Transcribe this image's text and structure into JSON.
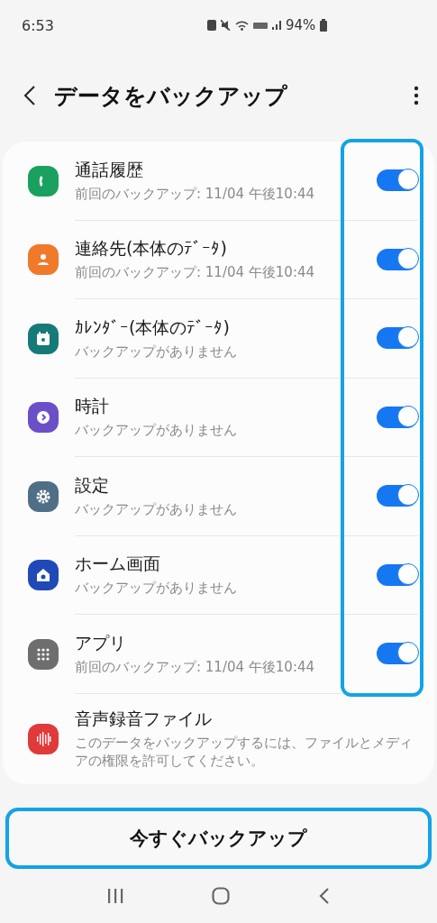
{
  "status_bar": {
    "time": "6:53",
    "battery": "94%"
  },
  "header": {
    "title": "データをバックアップ"
  },
  "items": [
    {
      "kind": "toggle",
      "color": "#1aa160",
      "title": "通話履歴",
      "subtitle": "前回のバックアップ: 11/04 午後10:44",
      "on": true
    },
    {
      "kind": "toggle",
      "color": "#f07a2a",
      "title": "連絡先(本体のﾃﾞｰﾀ)",
      "subtitle": "前回のバックアップ: 11/04 午後10:44",
      "on": true
    },
    {
      "kind": "toggle",
      "color": "#167a78",
      "title": "ｶﾚﾝﾀﾞｰ(本体のﾃﾞｰﾀ)",
      "subtitle": "バックアップがありません",
      "on": true
    },
    {
      "kind": "toggle",
      "color": "#6a4fc8",
      "title": "時計",
      "subtitle": "バックアップがありません",
      "on": true
    },
    {
      "kind": "toggle",
      "color": "#4f6f86",
      "title": "設定",
      "subtitle": "バックアップがありません",
      "on": true
    },
    {
      "kind": "toggle",
      "color": "#2049b8",
      "title": "ホーム画面",
      "subtitle": "バックアップがありません",
      "on": true
    },
    {
      "kind": "toggle",
      "color": "#6e6e6e",
      "title": "アプリ",
      "subtitle": "前回のバックアップ: 11/04 午後10:44",
      "on": true
    },
    {
      "kind": "info",
      "color": "#e03a3a",
      "title": "音声録音ファイル",
      "subtitle": "このデータをバックアップするには、ファイルとメディアの権限を許可してください。"
    }
  ],
  "backup_button": {
    "label": "今すぐバックアップ"
  }
}
